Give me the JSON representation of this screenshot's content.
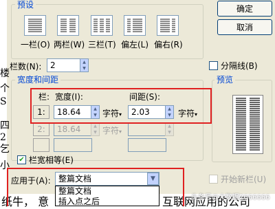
{
  "document_bg": {
    "left_chars": [
      "楼",
      "个",
      "S",
      "四",
      "2",
      "乞",
      "小"
    ],
    "bottom_text_left": "纸牛，  意",
    "bottom_text_right": "互联网应用的公司",
    "watermark": "头条号@大数据2666666"
  },
  "dialog": {
    "presets_label": "预设",
    "presets": [
      {
        "label": "一栏(O)",
        "type": "one"
      },
      {
        "label": "两栏(W)",
        "type": "two"
      },
      {
        "label": "三栏(T)",
        "type": "three"
      },
      {
        "label": "偏左(L)",
        "type": "left"
      },
      {
        "label": "偏右(R)",
        "type": "right"
      }
    ],
    "ok_button": "确定",
    "cancel_button": "取消",
    "columns_label": "栏数(N):",
    "columns_value": "2",
    "separator_label": "分隔线(B)",
    "width_spacing_label": "宽度和间距",
    "preview_label": "预览",
    "col_header": "栏:",
    "width_header": "宽度(I):",
    "spacing_header": "间距(S):",
    "rows": [
      {
        "num": "1:",
        "width": "18.64",
        "width_unit": "字符",
        "spacing": "2.03",
        "spacing_unit": "字符",
        "enabled": true
      },
      {
        "num": "2:",
        "width": "18.64",
        "width_unit": "字符",
        "spacing": "",
        "spacing_unit": "",
        "enabled": false
      },
      {
        "num": "",
        "width": "",
        "width_unit": "",
        "spacing": "",
        "spacing_unit": "",
        "enabled": false
      }
    ],
    "equal_width_label": "栏宽相等(E)",
    "equal_width_checked": true,
    "apply_to_label": "应用于(A):",
    "apply_to_value": "整篇文档",
    "apply_options": [
      "整篇文档",
      "插入点之后"
    ],
    "new_column_label": "开始新栏(U)"
  },
  "colors": {
    "highlight_red": "#e02020",
    "legend_blue": "#0046d5",
    "dialog_bg": "#ece9d8"
  }
}
